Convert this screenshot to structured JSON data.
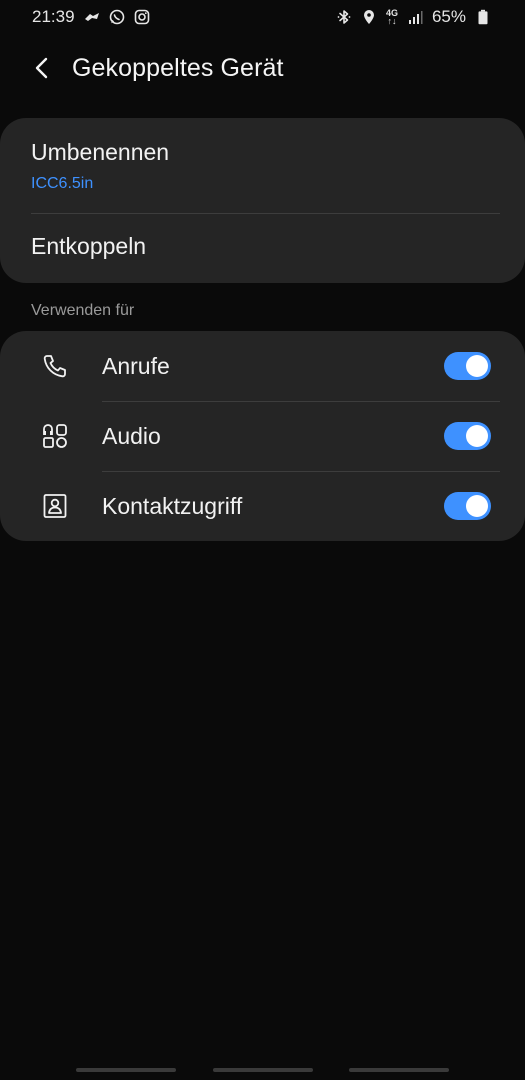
{
  "status_bar": {
    "time": "21:39",
    "network_label_top": "4G",
    "network_label_bottom": "↑↓",
    "battery_percent": "65%"
  },
  "header": {
    "title": "Gekoppeltes Gerät"
  },
  "device": {
    "rename_label": "Umbenennen",
    "device_name": "ICC6.5in",
    "unpair_label": "Entkoppeln"
  },
  "usage": {
    "section_title": "Verwenden für",
    "items": [
      {
        "label": "Anrufe",
        "icon": "phone-icon",
        "enabled": true
      },
      {
        "label": "Audio",
        "icon": "audio-icon",
        "enabled": true
      },
      {
        "label": "Kontaktzugriff",
        "icon": "contact-icon",
        "enabled": true
      }
    ]
  },
  "colors": {
    "background": "#0a0a0a",
    "card": "#252525",
    "accent": "#3e91ff",
    "secondary_text": "#9a9a9a"
  }
}
